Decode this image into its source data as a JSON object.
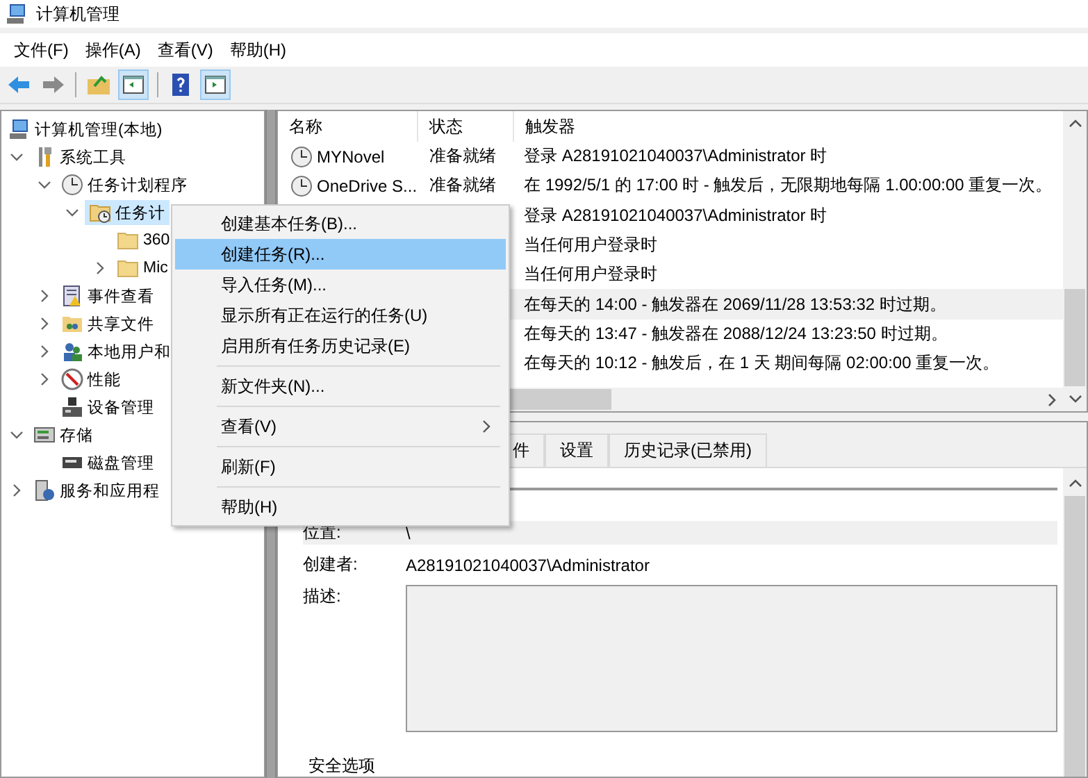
{
  "window": {
    "title": "计算机管理"
  },
  "menubar": [
    "文件(F)",
    "操作(A)",
    "查看(V)",
    "帮助(H)"
  ],
  "tree": [
    {
      "label": "计算机管理(本地)",
      "kind": "computer",
      "selected": false,
      "children": [
        {
          "label": "系统工具",
          "kind": "tools",
          "expanded": true,
          "selected": false,
          "children": [
            {
              "label": "任务计划程序",
              "kind": "clock",
              "expanded": true,
              "selected": false,
              "children": [
                {
                  "label": "任务计",
                  "kind": "folder-clock",
                  "expanded": true,
                  "selected": true,
                  "children": [
                    {
                      "label": "360",
                      "kind": "folder",
                      "selected": false
                    },
                    {
                      "label": "Mic",
                      "kind": "folder",
                      "expanded": false,
                      "selected": false
                    }
                  ]
                }
              ]
            },
            {
              "label": "事件查看",
              "kind": "log",
              "expanded": false,
              "selected": false
            },
            {
              "label": "共享文件",
              "kind": "share",
              "expanded": false,
              "selected": false
            },
            {
              "label": "本地用户和",
              "kind": "users",
              "expanded": false,
              "selected": false
            },
            {
              "label": "性能",
              "kind": "gauge",
              "expanded": false,
              "selected": false
            },
            {
              "label": "设备管理",
              "kind": "device",
              "selected": false
            }
          ]
        },
        {
          "label": "存储",
          "kind": "storage",
          "expanded": true,
          "selected": false,
          "children": [
            {
              "label": "磁盘管理",
              "kind": "disk",
              "selected": false
            }
          ]
        },
        {
          "label": "服务和应用程",
          "kind": "services",
          "expanded": false,
          "selected": false
        }
      ]
    }
  ],
  "task_list": {
    "columns": [
      "名称",
      "状态",
      "触发器"
    ],
    "rows": [
      {
        "name": "MYNovel",
        "status": "准备就绪",
        "trigger": "登录 A28191021040037\\Administrator 时",
        "selected": false
      },
      {
        "name": "OneDrive S...",
        "status": "准备就绪",
        "trigger": "在 1992/5/1 的 17:00 时 - 触发后，无限期地每隔 1.00:00:00 重复一次。",
        "selected": false
      },
      {
        "trigger": "登录 A28191021040037\\Administrator 时",
        "selected": false
      },
      {
        "trigger": "当任何用户登录时",
        "selected": false
      },
      {
        "trigger": "当任何用户登录时",
        "selected": false
      },
      {
        "trigger": "在每天的 14:00 - 触发器在 2069/11/28 13:53:32 时过期。",
        "selected": true
      },
      {
        "trigger": "在每天的 13:47 - 触发器在 2088/12/24 13:23:50 时过期。",
        "selected": false
      },
      {
        "trigger": "在每天的 10:12 - 触发后，在 1 天 期间每隔 02:00:00 重复一次。",
        "selected": false
      }
    ]
  },
  "detail": {
    "tabs": [
      {
        "label": "件",
        "selected": false
      },
      {
        "label": "设置",
        "selected": false
      },
      {
        "label": "历史记录(已禁用)",
        "selected": false
      }
    ],
    "location_label": "位置:",
    "location_value": "\\",
    "author_label": "创建者:",
    "author_value": "A28191021040037\\Administrator",
    "description_label": "描述:",
    "security_label": "安全选项"
  },
  "context_menu": [
    {
      "kind": "item",
      "label": "创建基本任务(B)...",
      "selected": false
    },
    {
      "kind": "item",
      "label": "创建任务(R)...",
      "selected": true
    },
    {
      "kind": "item",
      "label": "导入任务(M)...",
      "selected": false
    },
    {
      "kind": "item",
      "label": "显示所有正在运行的任务(U)",
      "selected": false
    },
    {
      "kind": "item",
      "label": "启用所有任务历史记录(E)",
      "selected": false
    },
    {
      "kind": "separator"
    },
    {
      "kind": "item",
      "label": "新文件夹(N)...",
      "selected": false
    },
    {
      "kind": "separator"
    },
    {
      "kind": "item",
      "label": "查看(V)",
      "selected": false,
      "submenu": true
    },
    {
      "kind": "separator"
    },
    {
      "kind": "item",
      "label": "刷新(F)",
      "selected": false
    },
    {
      "kind": "separator"
    },
    {
      "kind": "item",
      "label": "帮助(H)",
      "selected": false
    }
  ]
}
